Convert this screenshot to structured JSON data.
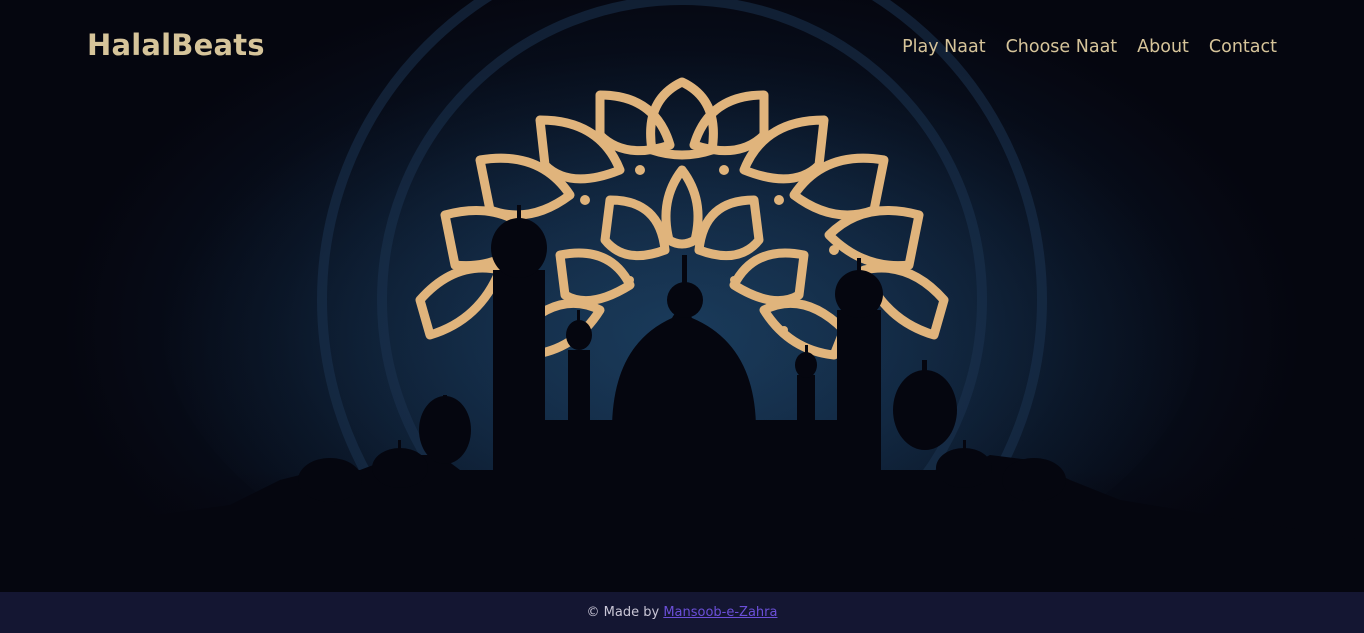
{
  "navbar": {
    "brand": "HalalBeats",
    "links": [
      "Play Naat",
      "Choose Naat",
      "About",
      "Contact"
    ]
  },
  "hero": {
    "image": "mosque-silhouette-with-golden-mandala",
    "colors": {
      "gold": "#e0b47c",
      "background": "#0e1f36",
      "silhouette": "#05060f"
    }
  },
  "footer": {
    "prefix": "© Made by",
    "author": "Mansoob-e-Zahra"
  }
}
